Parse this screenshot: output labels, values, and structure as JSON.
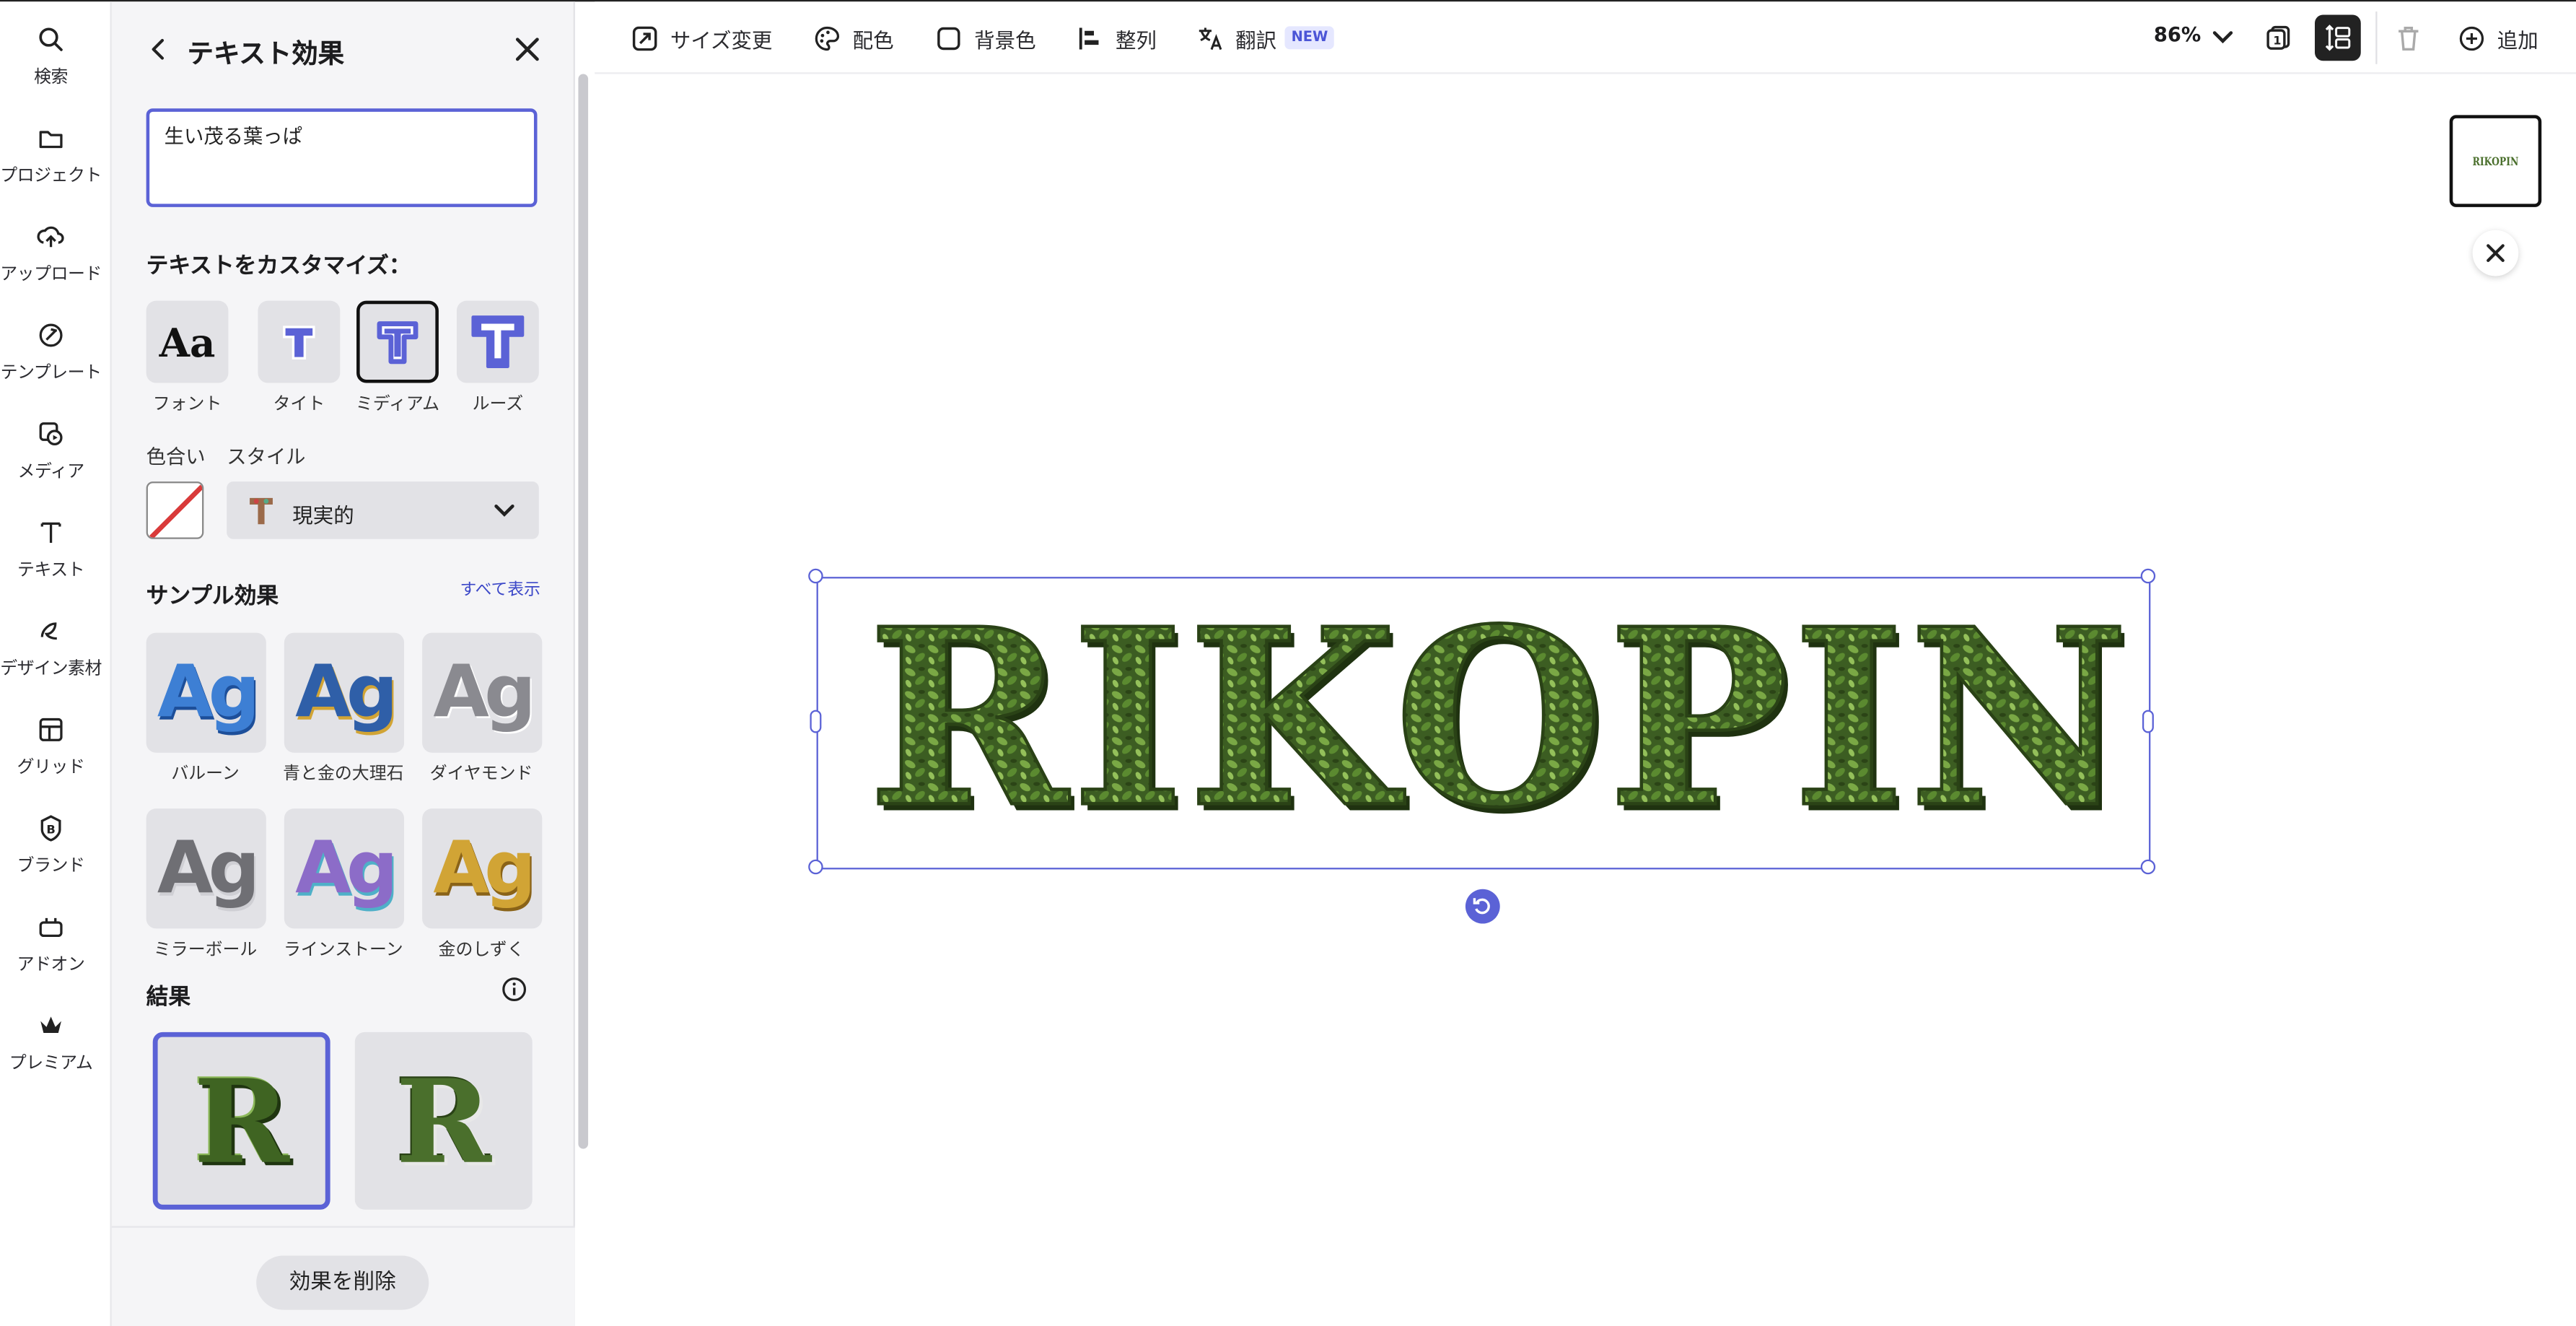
{
  "rail": [
    {
      "label": "検索",
      "icon": "search-icon"
    },
    {
      "label": "プロジェクト",
      "icon": "folder-icon"
    },
    {
      "label": "アップロード",
      "icon": "cloud-upload-icon"
    },
    {
      "label": "テンプレート",
      "icon": "template-icon"
    },
    {
      "label": "メディア",
      "icon": "media-icon"
    },
    {
      "label": "テキスト",
      "icon": "text-icon"
    },
    {
      "label": "デザイン素材",
      "icon": "shapes-icon"
    },
    {
      "label": "グリッド",
      "icon": "grid-icon"
    },
    {
      "label": "ブランド",
      "icon": "brand-icon"
    },
    {
      "label": "アドオン",
      "icon": "addon-icon"
    },
    {
      "label": "プレミアム",
      "icon": "crown-icon"
    }
  ],
  "panel": {
    "title": "テキスト効果",
    "prompt_value": "生い茂る葉っぱ",
    "customize_label": "テキストをカスタマイズ：",
    "options": [
      {
        "label": "フォント"
      },
      {
        "label": "タイト"
      },
      {
        "label": "ミディアム"
      },
      {
        "label": "ルーズ"
      }
    ],
    "color_label": "色合い",
    "style_label": "スタイル",
    "style_value": "現実的",
    "samples_label": "サンプル効果",
    "show_all": "すべて表示",
    "samples": [
      {
        "label": "バルーン",
        "text": "Ag",
        "color": "#3d7fd4"
      },
      {
        "label": "青と金の大理石",
        "text": "Ag",
        "color": "#2f5fa8"
      },
      {
        "label": "ダイヤモンド",
        "text": "Ag",
        "color": "#8a8a90"
      },
      {
        "label": "ミラーボール",
        "text": "Ag",
        "color": "#6f6f74"
      },
      {
        "label": "ラインストーン",
        "text": "Ag",
        "color": "#8c6cc8"
      },
      {
        "label": "金のしずく",
        "text": "Ag",
        "color": "#d1a435"
      }
    ],
    "results_label": "結果",
    "results": [
      {
        "text": "R"
      },
      {
        "text": "R"
      }
    ],
    "remove_button": "効果を削除"
  },
  "toolbar": {
    "resize": "サイズ変更",
    "palette": "配色",
    "background": "背景色",
    "align": "整列",
    "translate": "翻訳",
    "new_badge": "NEW",
    "zoom": "86%",
    "add": "追加"
  },
  "canvas": {
    "text": "RIKOPIN",
    "thumb_text": "RIKOPIN"
  },
  "colors": {
    "accent": "#5b62d6",
    "foliage_dark": "#2e4a18",
    "foliage_light": "#6f9a3c"
  }
}
